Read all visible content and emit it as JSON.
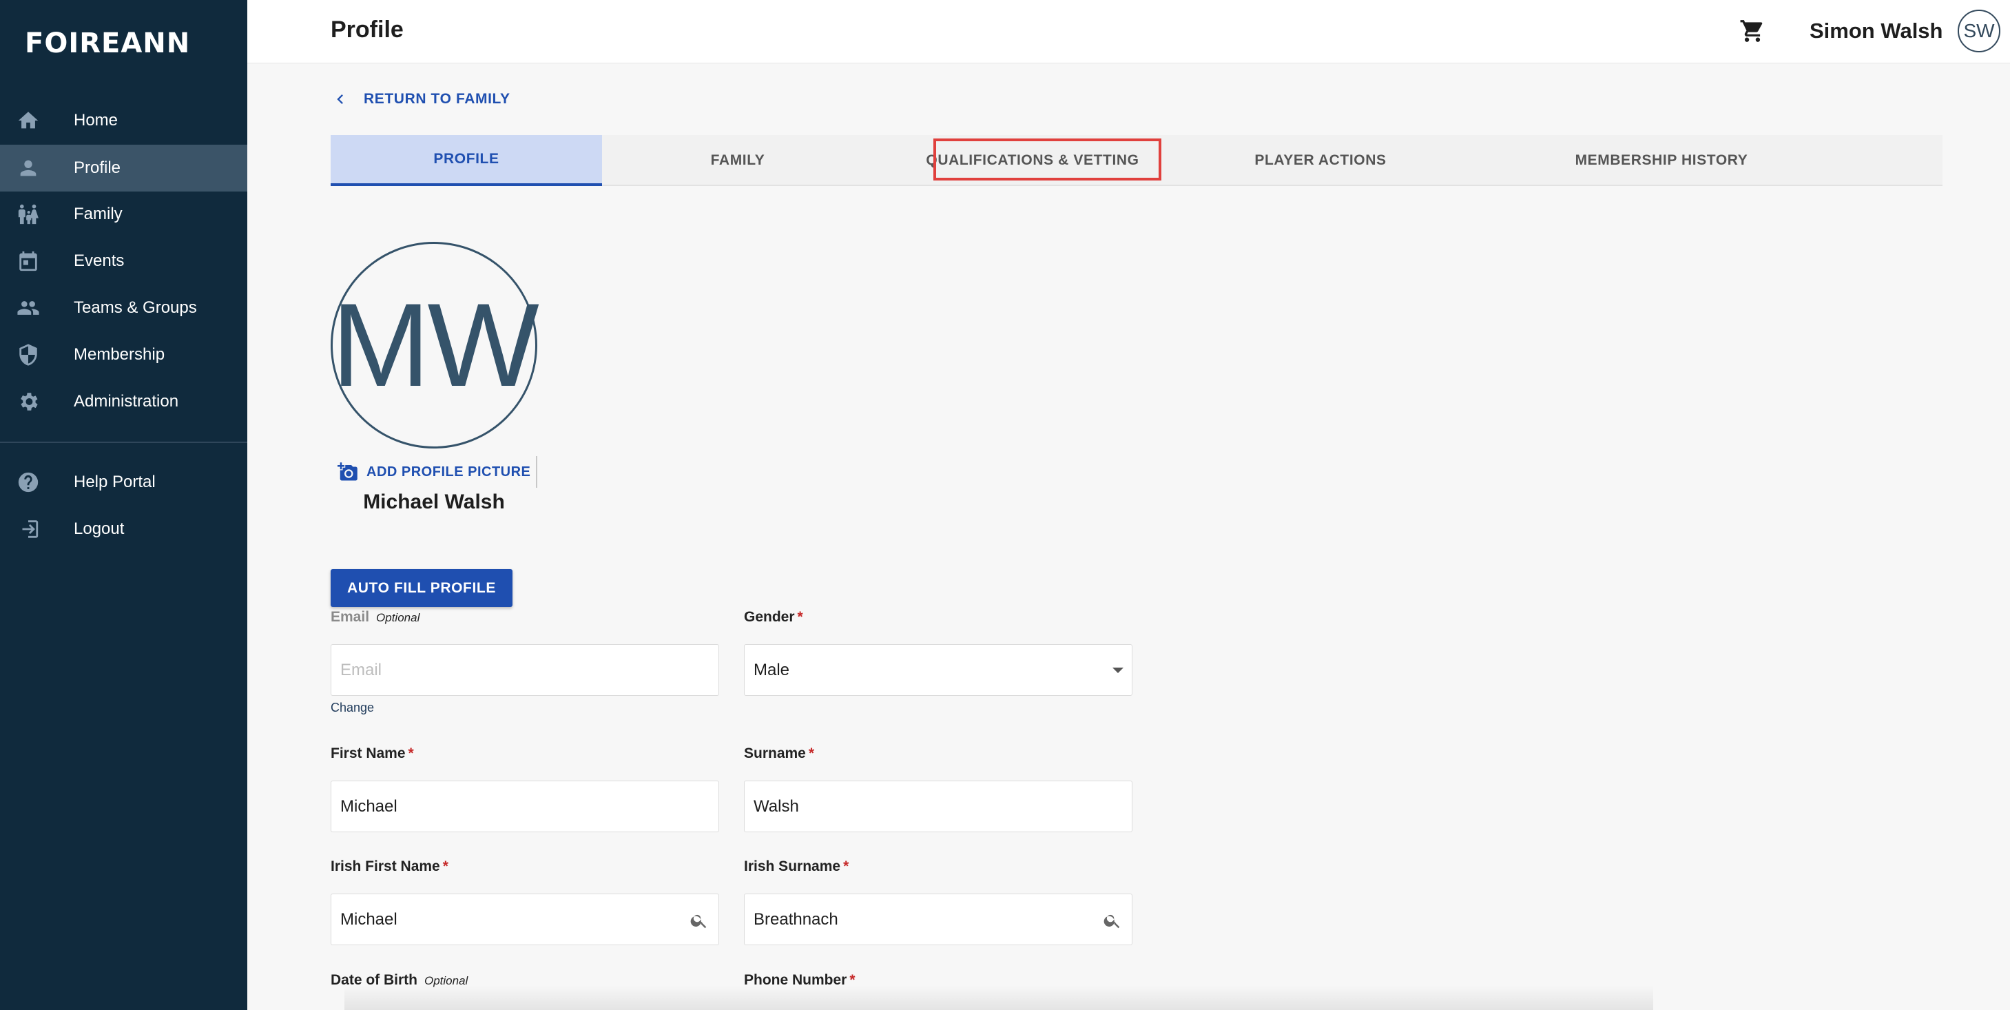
{
  "app": {
    "logo": "FOIREANN"
  },
  "sidebar": {
    "items": [
      {
        "label": "Home",
        "icon": "home-icon"
      },
      {
        "label": "Profile",
        "icon": "person-icon"
      },
      {
        "label": "Family",
        "icon": "family-icon"
      },
      {
        "label": "Events",
        "icon": "calendar-icon"
      },
      {
        "label": "Teams & Groups",
        "icon": "group-icon"
      },
      {
        "label": "Membership",
        "icon": "shield-icon"
      },
      {
        "label": "Administration",
        "icon": "gear-icon"
      }
    ],
    "footer_items": [
      {
        "label": "Help Portal",
        "icon": "help-icon"
      },
      {
        "label": "Logout",
        "icon": "logout-icon"
      }
    ],
    "active": "Profile"
  },
  "header": {
    "title": "Profile",
    "user_name": "Simon Walsh",
    "user_initials": "SW"
  },
  "main": {
    "return_link": "RETURN TO FAMILY",
    "tabs": [
      {
        "label": "PROFILE"
      },
      {
        "label": "FAMILY"
      },
      {
        "label": "QUALIFICATIONS & VETTING"
      },
      {
        "label": "PLAYER ACTIONS"
      },
      {
        "label": "MEMBERSHIP HISTORY"
      }
    ],
    "active_tab": "PROFILE",
    "highlighted_tab": "QUALIFICATIONS & VETTING",
    "avatar_initials": "MW",
    "add_picture_label": "ADD PROFILE PICTURE",
    "member_name": "Michael Walsh",
    "autofill_label": "AUTO FILL PROFILE"
  },
  "form": {
    "email": {
      "label": "Email",
      "hint": "Optional",
      "placeholder": "Email",
      "value": "",
      "change_label": "Change"
    },
    "gender": {
      "label": "Gender",
      "required": "*",
      "value": "Male"
    },
    "first_name": {
      "label": "First Name",
      "required": "*",
      "value": "Michael"
    },
    "surname": {
      "label": "Surname",
      "required": "*",
      "value": "Walsh"
    },
    "irish_first_name": {
      "label": "Irish First Name",
      "required": "*",
      "value": "Michael"
    },
    "irish_surname": {
      "label": "Irish Surname",
      "required": "*",
      "value": "Breathnach"
    },
    "dob": {
      "label": "Date of Birth",
      "hint": "Optional"
    },
    "phone": {
      "label": "Phone Number",
      "required": "*"
    }
  },
  "colors": {
    "sidebar_bg": "#102a3d",
    "accent": "#1f4fb0",
    "highlight": "#e0403d",
    "required": "#c62828"
  }
}
